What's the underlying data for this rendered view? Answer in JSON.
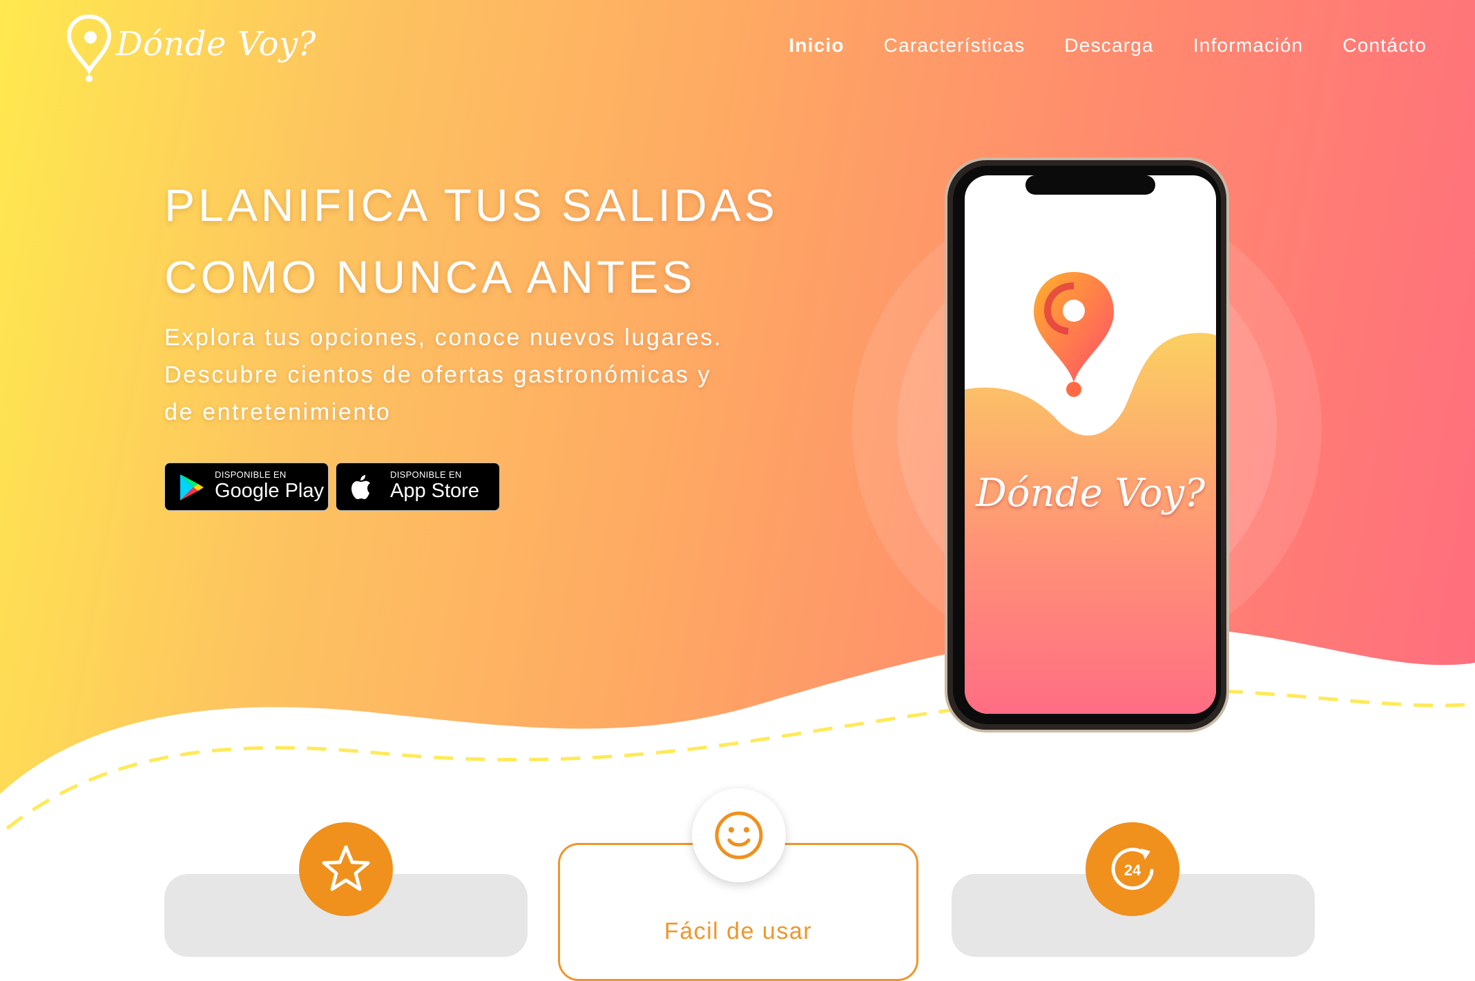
{
  "brand": {
    "name": "Dónde Voy?"
  },
  "nav": {
    "items": [
      {
        "label": "Inicio"
      },
      {
        "label": "Características"
      },
      {
        "label": "Descarga"
      },
      {
        "label": "Información"
      },
      {
        "label": "Contácto"
      }
    ]
  },
  "hero": {
    "headline_line1": "PLANIFICA TUS SALIDAS",
    "headline_line2": "COMO NUNCA ANTES",
    "sub_line1": "Explora tus opciones, conoce nuevos lugares.",
    "sub_line2": "Descubre cientos de ofertas gastronómicas y",
    "sub_line3": "de entretenimiento"
  },
  "badges": {
    "google_small": "DISPONIBLE EN",
    "google_big": "Google Play",
    "apple_small": "DISPONIBLE EN",
    "apple_big": "App Store"
  },
  "phone": {
    "app_name": "Dónde Voy?"
  },
  "features": {
    "center_title": "Fácil de usar",
    "right_icon_text": "24"
  },
  "colors": {
    "accent_orange": "#f0901d",
    "gradient_start": "#ffe94f",
    "gradient_end": "#ff6b7f"
  },
  "icons": [
    "logo-pin-icon",
    "google-play-icon",
    "apple-icon",
    "star-icon",
    "smile-icon",
    "refresh-24-icon"
  ]
}
